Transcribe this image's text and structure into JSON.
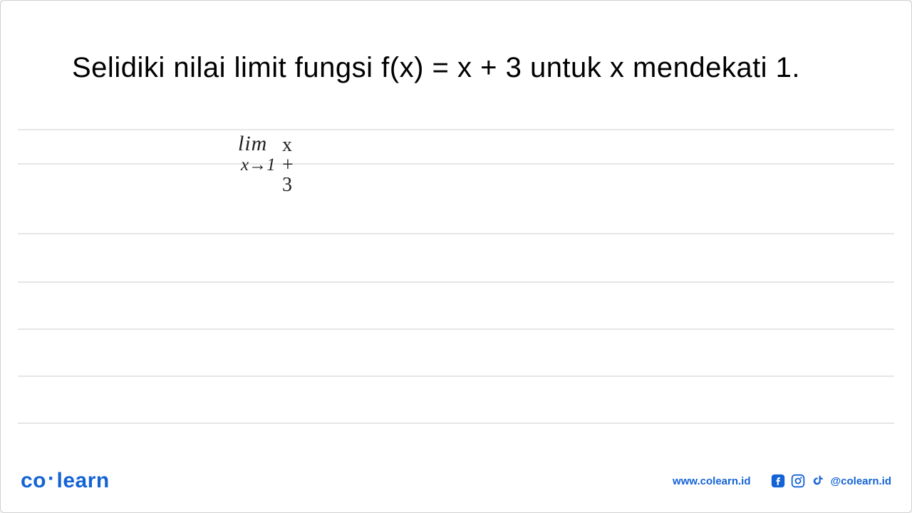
{
  "question": {
    "text": "Selidiki nilai limit fungsi f(x) = x + 3 untuk x mendekati 1."
  },
  "handwriting": {
    "lim_label": "lim",
    "lim_condition": "x→1",
    "expression": "x + 3"
  },
  "footer": {
    "brand_co": "co",
    "brand_dot": "·",
    "brand_learn": "learn",
    "website": "www.colearn.id",
    "handle": "@colearn.id"
  }
}
